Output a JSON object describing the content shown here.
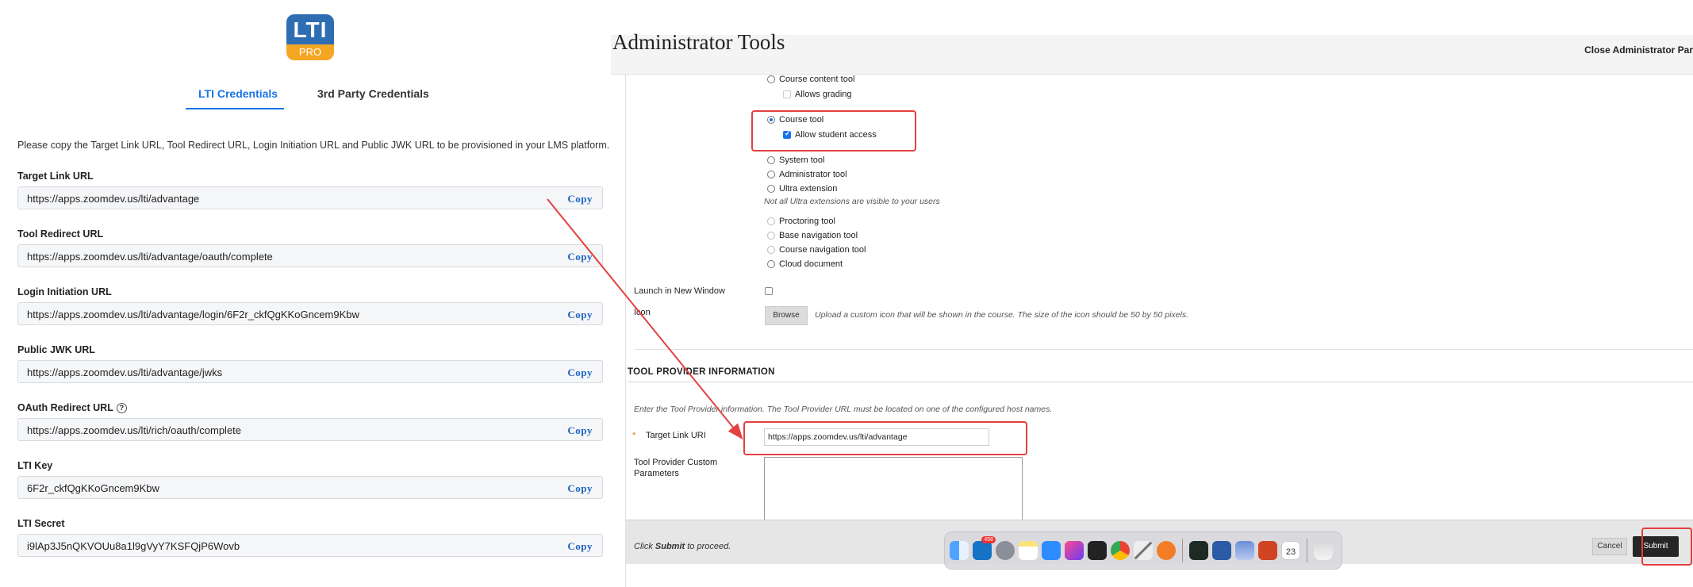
{
  "left_panel": {
    "logo": {
      "top_text": "LTI",
      "bottom_text": "PRO"
    },
    "tabs": [
      {
        "label": "LTI Credentials",
        "active": true
      },
      {
        "label": "3rd Party Credentials",
        "active": false
      }
    ],
    "intro": "Please copy the Target Link URL, Tool Redirect URL, Login Initiation URL and Public JWK URL to be provisioned in your LMS platform.",
    "copy_label": "Copy",
    "fields": [
      {
        "label": "Target Link URL",
        "value": "https://apps.zoomdev.us/lti/advantage"
      },
      {
        "label": "Tool Redirect URL",
        "value": "https://apps.zoomdev.us/lti/advantage/oauth/complete"
      },
      {
        "label": "Login Initiation URL",
        "value": "https://apps.zoomdev.us/lti/advantage/login/6F2r_ckfQgKKoGncem9Kbw"
      },
      {
        "label": "Public JWK URL",
        "value": "https://apps.zoomdev.us/lti/advantage/jwks"
      },
      {
        "label": "OAuth Redirect URL",
        "value": "https://apps.zoomdev.us/lti/rich/oauth/complete"
      },
      {
        "label": "LTI Key",
        "value": "6F2r_ckfQgKKoGncem9Kbw"
      },
      {
        "label": "LTI Secret",
        "value": "i9lAp3J5nQKVOUu8a1l9gVyY7KSFQjP6Wovb"
      }
    ]
  },
  "right_panel": {
    "title": "Administrator Tools",
    "close_label": "Close Administrator Par",
    "options": {
      "course_content_tool": "Course content tool",
      "allows_grading": "Allows grading",
      "course_tool": "Course tool",
      "allow_student_access": "Allow student access",
      "system_tool": "System tool",
      "administrator_tool": "Administrator tool",
      "ultra_extension": "Ultra extension",
      "ultra_note": "Not all Ultra extensions are visible to your users",
      "proctoring_tool": "Proctoring tool",
      "base_navigation_tool": "Base navigation tool",
      "course_navigation_tool": "Course navigation tool",
      "cloud_document": "Cloud document"
    },
    "launch_new_window_label": "Launch in New Window",
    "icon_label": "Icon",
    "browse_label": "Browse",
    "icon_note": "Upload a custom icon that will be shown in the course. The size of the icon should be 50 by 50 pixels.",
    "section_title": "TOOL PROVIDER INFORMATION",
    "section_note": "Enter the Tool Provider information. The Tool Provider URL must be located on one of the configured host names.",
    "required_star": "*",
    "target_link_label": "Target Link URI",
    "target_link_value": "https://apps.zoomdev.us/lti/advantage",
    "custom_params_label_1": "Tool Provider Custom",
    "custom_params_label_2": "Parameters",
    "footer_pre": "Click ",
    "footer_bold": "Submit",
    "footer_post": " to proceed.",
    "cancel_label": "Cancel",
    "submit_label": "Submit"
  },
  "dock": {
    "mail_badge": "458",
    "calendar_day": "23",
    "icons": [
      "finder-icon",
      "outlook-icon",
      "rocket-icon",
      "notes-icon",
      "zoom-icon",
      "intellij-icon",
      "terminal-icon",
      "chrome-icon",
      "pen-icon",
      "safari-icon",
      "activity-monitor-icon",
      "word-icon",
      "preview-icon",
      "powerpoint-icon",
      "calendar-icon",
      "trash-icon"
    ]
  },
  "colors": {
    "accent_blue": "#1a73e8",
    "annotation_red": "#e34040",
    "copy_blue": "#1a63c2"
  }
}
